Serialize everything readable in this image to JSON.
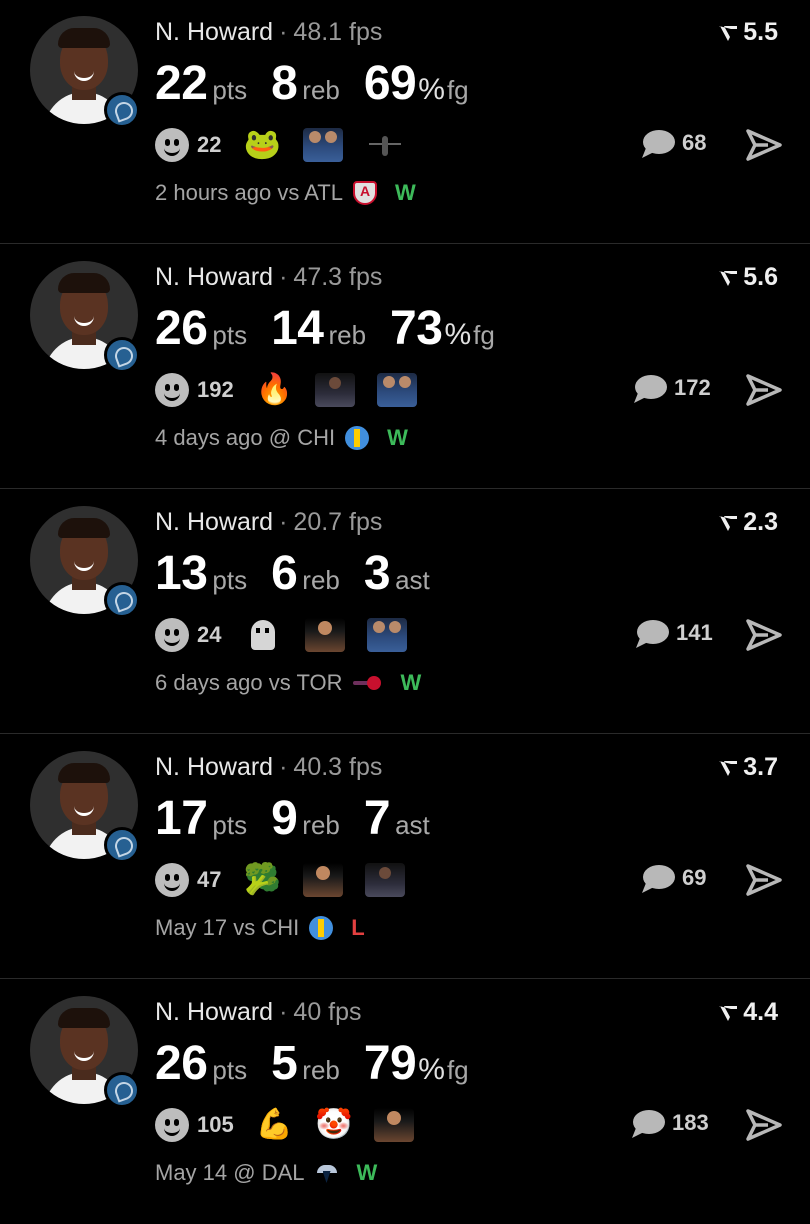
{
  "cards": [
    {
      "name": "N. Howard",
      "fps": "48.1 fps",
      "rating": "5.5",
      "stats": [
        {
          "value": "22",
          "unit": "pts"
        },
        {
          "value": "8",
          "unit": "reb"
        },
        {
          "value": "69",
          "unit_pct": "%",
          "unit": "fg"
        }
      ],
      "reaction_count": "22",
      "reaction_items": [
        "frog-emoji",
        "two-people-sticker",
        "figure-sticker"
      ],
      "comment_count": "68",
      "time": "2 hours ago",
      "matchup": "vs ATL",
      "opponent_logo": "atlanta-dream-logo",
      "result": "W"
    },
    {
      "name": "N. Howard",
      "fps": "47.3 fps",
      "rating": "5.6",
      "stats": [
        {
          "value": "26",
          "unit": "pts"
        },
        {
          "value": "14",
          "unit": "reb"
        },
        {
          "value": "73",
          "unit_pct": "%",
          "unit": "fg"
        }
      ],
      "reaction_count": "192",
      "reaction_items": [
        "fire-emoji",
        "dark-photo-sticker",
        "two-people-sticker"
      ],
      "comment_count": "172",
      "time": "4 days ago",
      "matchup": "@ CHI",
      "opponent_logo": "chicago-sky-logo",
      "result": "W"
    },
    {
      "name": "N. Howard",
      "fps": "20.7 fps",
      "rating": "2.3",
      "stats": [
        {
          "value": "13",
          "unit": "pts"
        },
        {
          "value": "6",
          "unit": "reb"
        },
        {
          "value": "3",
          "unit": "ast"
        }
      ],
      "reaction_count": "24",
      "reaction_items": [
        "ghost-emoji",
        "person-photo-sticker",
        "two-people-sticker"
      ],
      "comment_count": "141",
      "time": "6 days ago",
      "matchup": "vs TOR",
      "opponent_logo": "toronto-tempo-logo",
      "result": "W"
    },
    {
      "name": "N. Howard",
      "fps": "40.3 fps",
      "rating": "3.7",
      "stats": [
        {
          "value": "17",
          "unit": "pts"
        },
        {
          "value": "9",
          "unit": "reb"
        },
        {
          "value": "7",
          "unit": "ast"
        }
      ],
      "reaction_count": "47",
      "reaction_items": [
        "broccoli-emoji",
        "person-photo-sticker",
        "dark-photo-sticker"
      ],
      "comment_count": "69",
      "time": "May 17",
      "matchup": "vs CHI",
      "opponent_logo": "chicago-sky-logo",
      "result": "L"
    },
    {
      "name": "N. Howard",
      "fps": "40 fps",
      "rating": "4.4",
      "stats": [
        {
          "value": "26",
          "unit": "pts"
        },
        {
          "value": "5",
          "unit": "reb"
        },
        {
          "value": "79",
          "unit_pct": "%",
          "unit": "fg"
        }
      ],
      "reaction_count": "105",
      "reaction_items": [
        "flexed-biceps-emoji",
        "clown-emoji",
        "person-photo-sticker"
      ],
      "comment_count": "183",
      "time": "May 14",
      "matchup": "@ DAL",
      "opponent_logo": "dallas-wings-logo",
      "result": "W"
    }
  ],
  "colors": {
    "background": "#000000",
    "win": "#3dba5a",
    "loss": "#e34040",
    "muted_text": "#a5a5a5"
  }
}
